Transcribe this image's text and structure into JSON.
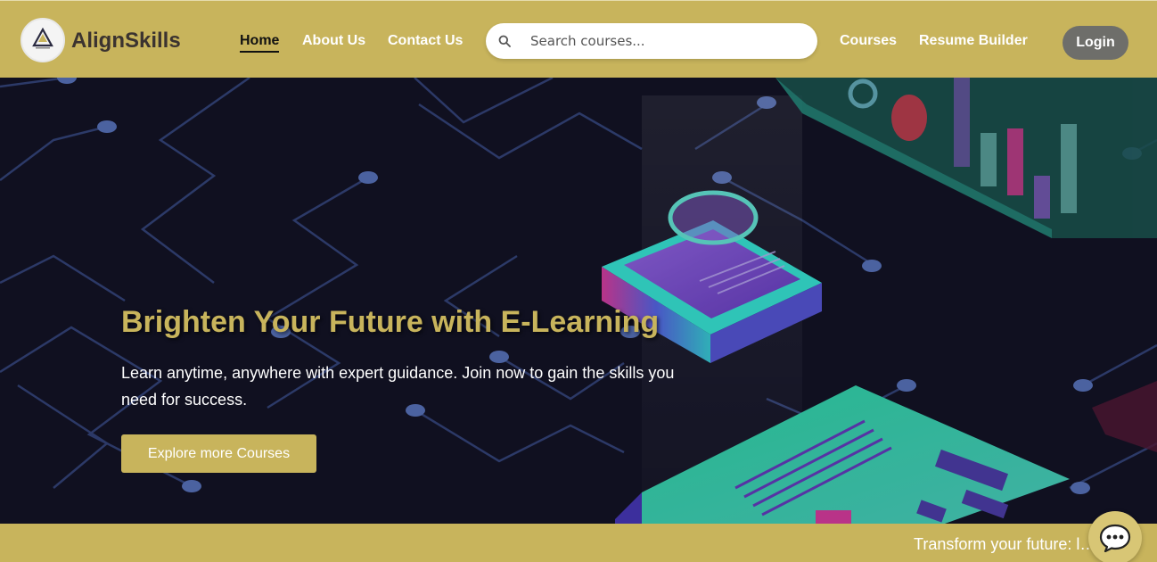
{
  "brand": {
    "name": "AlignSkills",
    "logo_icon": "triangle-logo-icon"
  },
  "nav": {
    "links": [
      "Home",
      "About Us",
      "Contact Us",
      "Courses",
      "Resume Builder"
    ],
    "active": "Home"
  },
  "search": {
    "placeholder": "Search courses...",
    "value": "",
    "icon": "search-icon"
  },
  "login": {
    "label": "Login"
  },
  "hero": {
    "title": "Brighten Your Future with E-Learning",
    "subtitle": "Learn anytime, anywhere with expert guidance. Join now to gain the skills you need for success.",
    "cta_label": "Explore more Courses"
  },
  "ticker": {
    "text": "Transform your future: l…or t"
  },
  "chat": {
    "icon": "chat-bubble-icon"
  },
  "colors": {
    "accent": "#c8b45c",
    "hero_bg": "#141428",
    "login_bg": "#6e6e6a",
    "brand_text": "#3b3330"
  }
}
